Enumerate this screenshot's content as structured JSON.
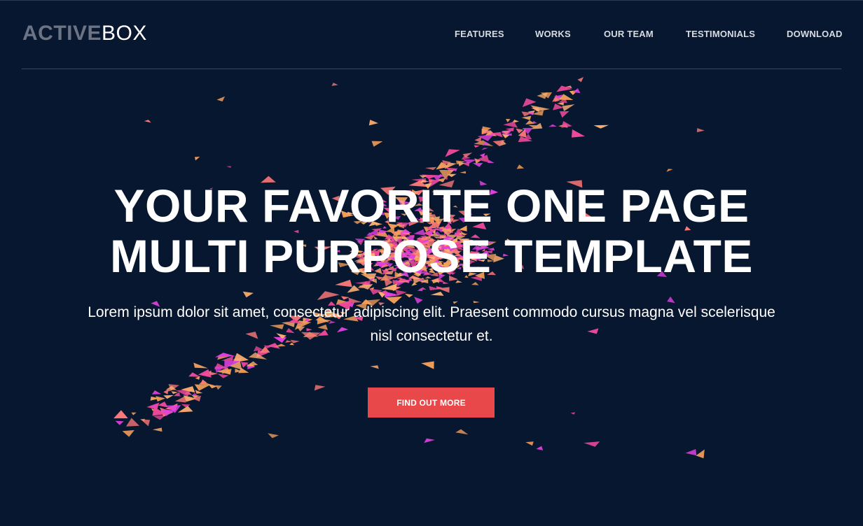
{
  "brand": {
    "strong": "ACTIVE",
    "light": "BOX"
  },
  "nav": {
    "items": [
      {
        "label": "FEATURES"
      },
      {
        "label": "WORKS"
      },
      {
        "label": "OUR TEAM"
      },
      {
        "label": "TESTIMONIALS"
      },
      {
        "label": "DOWNLOAD"
      }
    ]
  },
  "hero": {
    "title_line1": "YOUR FAVORITE ONE PAGE",
    "title_line2": "MULTI PURPOSE TEMPLATE",
    "text": "Lorem ipsum dolor sit amet, consectetur adipiscing elit. Praesent commodo cursus magna vel scelerisque nisl consectetur et.",
    "cta_label": "FIND OUT MORE"
  },
  "colors": {
    "background": "#081730",
    "accent": "#e8484a",
    "particle_pink": "#f04a9a",
    "particle_orange": "#f5a05a",
    "particle_magenta": "#e040e0"
  }
}
